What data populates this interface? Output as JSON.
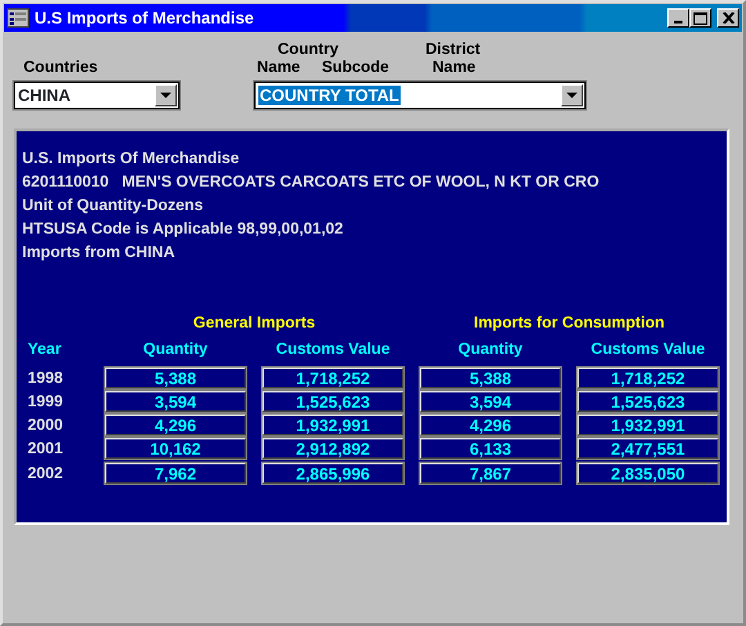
{
  "window": {
    "title": "U.S Imports of Merchandise"
  },
  "labels": {
    "countries": "Countries",
    "country_top": "Country",
    "country_name": "Name",
    "subcode": "Subcode",
    "district_top": "District",
    "district_name": "Name"
  },
  "countries_dropdown": {
    "value": "CHINA"
  },
  "country_name_dropdown": {
    "value": "COUNTRY TOTAL",
    "text_selected": true
  },
  "report": {
    "lines": [
      "U.S. Imports Of Merchandise",
      "6201110010   MEN'S OVERCOATS CARCOATS ETC OF WOOL, N KT OR CRO",
      "Unit of Quantity-Dozens",
      "HTSUSA Code is Applicable 98,99,00,01,02",
      "Imports from CHINA"
    ],
    "groups": [
      "General Imports",
      "Imports for Consumption"
    ],
    "columns": [
      "Year",
      "Quantity",
      "Customs Value",
      "Quantity",
      "Customs Value"
    ],
    "rows": [
      {
        "year": "1998",
        "values": [
          "5,388",
          "1,718,252",
          "5,388",
          "1,718,252"
        ]
      },
      {
        "year": "1999",
        "values": [
          "3,594",
          "1,525,623",
          "3,594",
          "1,525,623"
        ]
      },
      {
        "year": "2000",
        "values": [
          "4,296",
          "1,932,991",
          "4,296",
          "1,932,991"
        ]
      },
      {
        "year": "2001",
        "values": [
          "10,162",
          "2,912,892",
          "6,133",
          "2,477,551"
        ]
      },
      {
        "year": "2002",
        "values": [
          "7,962",
          "2,865,996",
          "7,867",
          "2,835,050"
        ]
      }
    ]
  }
}
